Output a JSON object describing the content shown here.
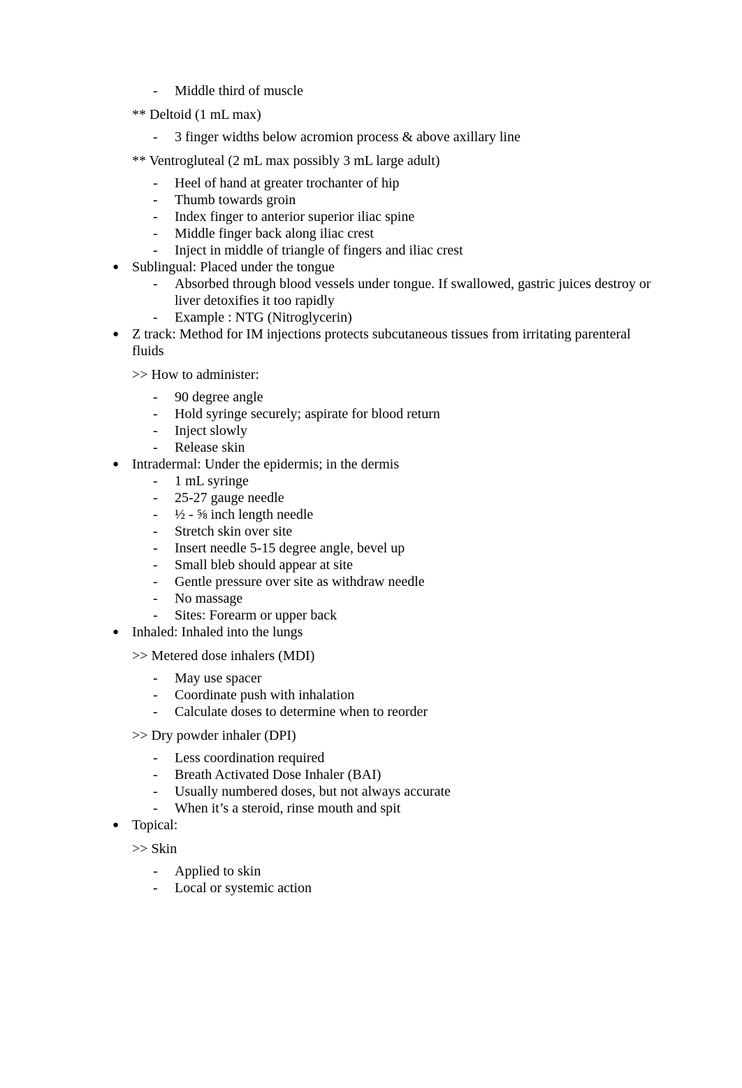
{
  "document": {
    "background_color": "#ffffff",
    "text_color": "#000000",
    "markers": {
      "bullet": "●",
      "dash": "-",
      "double_star": "**",
      "double_angle": ">>"
    },
    "blocks": [
      {
        "id": "im-sites-continued",
        "lines": [
          {
            "level": "dash",
            "text": "Middle third of muscle"
          },
          {
            "level": "sub",
            "marker": "**",
            "text": "** Deltoid (1 mL max)"
          },
          {
            "level": "dash",
            "text": "3 finger widths below acromion process & above axillary line"
          },
          {
            "level": "sub",
            "marker": "**",
            "text": "** Ventrogluteal (2 mL max possibly 3 mL large adult)"
          },
          {
            "level": "dash",
            "text": "Heel of hand at greater trochanter of hip"
          },
          {
            "level": "dash",
            "text": "Thumb towards groin"
          },
          {
            "level": "dash",
            "text": "Index finger to anterior superior iliac spine"
          },
          {
            "level": "dash",
            "text": "Middle finger back along iliac crest"
          },
          {
            "level": "dash",
            "text": "Inject in middle of triangle of fingers and iliac crest"
          }
        ]
      },
      {
        "id": "sublingual",
        "lines": [
          {
            "level": "bullet",
            "text": "Sublingual: Placed under the tongue"
          },
          {
            "level": "dash",
            "text": "Absorbed through blood vessels under tongue. If swallowed, gastric juices destroy or liver detoxifies it too rapidly"
          },
          {
            "level": "dash",
            "text": "Example : NTG (Nitroglycerin)"
          }
        ]
      },
      {
        "id": "z-track",
        "lines": [
          {
            "level": "bullet",
            "text": "Z track: Method for IM injections protects subcutaneous tissues from irritating parenteral fluids"
          },
          {
            "level": "sub",
            "marker": ">>",
            "text": ">> How to administer:"
          },
          {
            "level": "dash",
            "text": "90 degree angle"
          },
          {
            "level": "dash",
            "text": "Hold syringe securely; aspirate for blood return"
          },
          {
            "level": "dash",
            "text": "Inject slowly"
          },
          {
            "level": "dash",
            "text": "Release skin"
          }
        ]
      },
      {
        "id": "intradermal",
        "lines": [
          {
            "level": "bullet",
            "text": "Intradermal: Under the epidermis; in the dermis"
          },
          {
            "level": "dash",
            "text": "1 mL syringe"
          },
          {
            "level": "dash",
            "text": "25-27 gauge needle"
          },
          {
            "level": "dash",
            "text": "½ - ⅝ inch length needle"
          },
          {
            "level": "dash",
            "text": "Stretch skin over site"
          },
          {
            "level": "dash",
            "text": "Insert needle 5-15 degree angle, bevel up"
          },
          {
            "level": "dash",
            "text": "Small bleb should appear at site"
          },
          {
            "level": "dash",
            "text": "Gentle pressure over site as withdraw needle"
          },
          {
            "level": "dash",
            "text": "No massage"
          },
          {
            "level": "dash",
            "text": "Sites: Forearm or upper back"
          }
        ]
      },
      {
        "id": "inhaled",
        "lines": [
          {
            "level": "bullet",
            "text": "Inhaled: Inhaled into the lungs"
          },
          {
            "level": "sub",
            "marker": ">>",
            "text": ">> Metered dose inhalers (MDI)"
          },
          {
            "level": "dash",
            "text": "May use spacer"
          },
          {
            "level": "dash",
            "text": "Coordinate push with inhalation"
          },
          {
            "level": "dash",
            "text": "Calculate doses to determine when to reorder"
          },
          {
            "level": "sub",
            "marker": ">>",
            "text": ">> Dry powder inhaler (DPI)"
          },
          {
            "level": "dash",
            "text": "Less coordination required"
          },
          {
            "level": "dash",
            "text": "Breath Activated Dose Inhaler (BAI)"
          },
          {
            "level": "dash",
            "text": "Usually numbered doses, but not always accurate"
          },
          {
            "level": "dash",
            "text": "When it’s a steroid, rinse mouth and spit"
          }
        ]
      },
      {
        "id": "topical",
        "lines": [
          {
            "level": "bullet",
            "text": "Topical:"
          },
          {
            "level": "sub",
            "marker": ">>",
            "text": ">> Skin"
          },
          {
            "level": "dash",
            "text": "Applied to skin"
          },
          {
            "level": "dash",
            "text": "Local or systemic action"
          }
        ]
      }
    ]
  }
}
